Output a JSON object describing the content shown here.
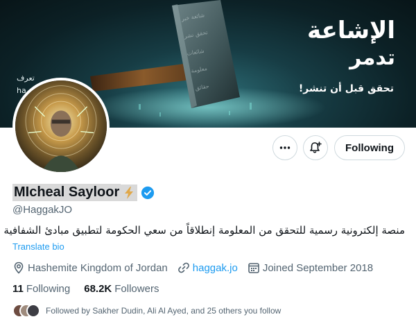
{
  "banner": {
    "title_line1": "الإشاعة",
    "title_line2": "تدمر",
    "tagline": "تحقق قبل أن تنشر!",
    "left_line1": "تعرف",
    "left_line2": "ha"
  },
  "profile": {
    "display_name": "MIcheal Sayloor",
    "handle": "@HaggakJO",
    "bio": "منصة إلكترونية رسمية للتحقق من المعلومة إنطلاقاً من سعي الحكومة لتطبيق مبادئ الشفافية",
    "translate_label": "Translate bio",
    "location": "Hashemite Kingdom of Jordan",
    "website": "haggak.jo",
    "joined": "Joined September 2018"
  },
  "actions": {
    "more_icon": "ellipsis-icon",
    "notify_icon": "bell-plus-icon",
    "following_label": "Following"
  },
  "stats": {
    "following_count": "11",
    "following_label": "Following",
    "followers_count": "68.2K",
    "followers_label": "Followers"
  },
  "followed_by": "Followed by Sakher Dudin, Ali Al Ayed, and 25 others you follow",
  "colors": {
    "accent": "#1d9bf0",
    "text_primary": "#0f1419",
    "text_secondary": "#536471",
    "border": "#cfd9de",
    "highlight": "#d9d9d9"
  }
}
